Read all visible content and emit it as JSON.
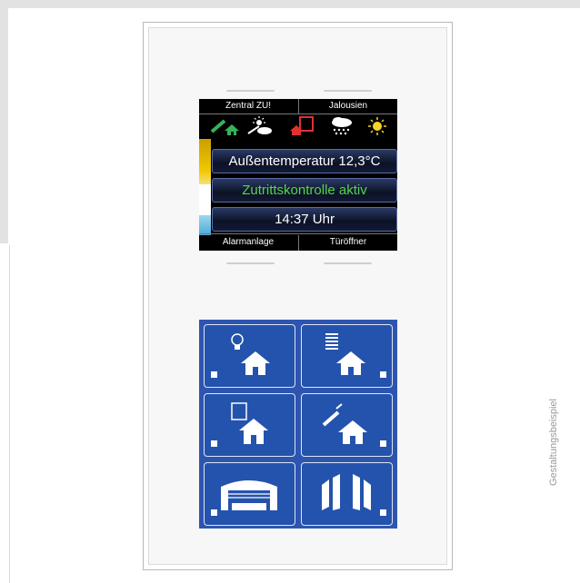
{
  "display": {
    "tabs_top": [
      "Zentral ZU!",
      "Jalousien"
    ],
    "tabs_bottom": [
      "Alarmanlage",
      "Türöffner"
    ],
    "status_icons": [
      "window-open-house-icon",
      "sun-cloud-icon",
      "door-house-icon",
      "snow-cloud-icon",
      "sun-icon"
    ],
    "temperature": "Außentemperatur 12,3°C",
    "access_status": "Zutrittskontrolle aktiv",
    "time": "14:37 Uhr",
    "colors": {
      "access_text": "#55d64a",
      "stripe": [
        "#f0c000",
        "#ffffff",
        "#7ec8e8"
      ]
    }
  },
  "keypad": {
    "keys": [
      {
        "icon": "light-bulb-house-icon"
      },
      {
        "icon": "blinds-house-icon"
      },
      {
        "icon": "door-house-icon"
      },
      {
        "icon": "window-house-icon"
      },
      {
        "icon": "garage-icon"
      },
      {
        "icon": "gate-icon"
      }
    ],
    "colors": {
      "background": "#2d55b0"
    }
  },
  "caption": "Gestaltungsbeispiel"
}
